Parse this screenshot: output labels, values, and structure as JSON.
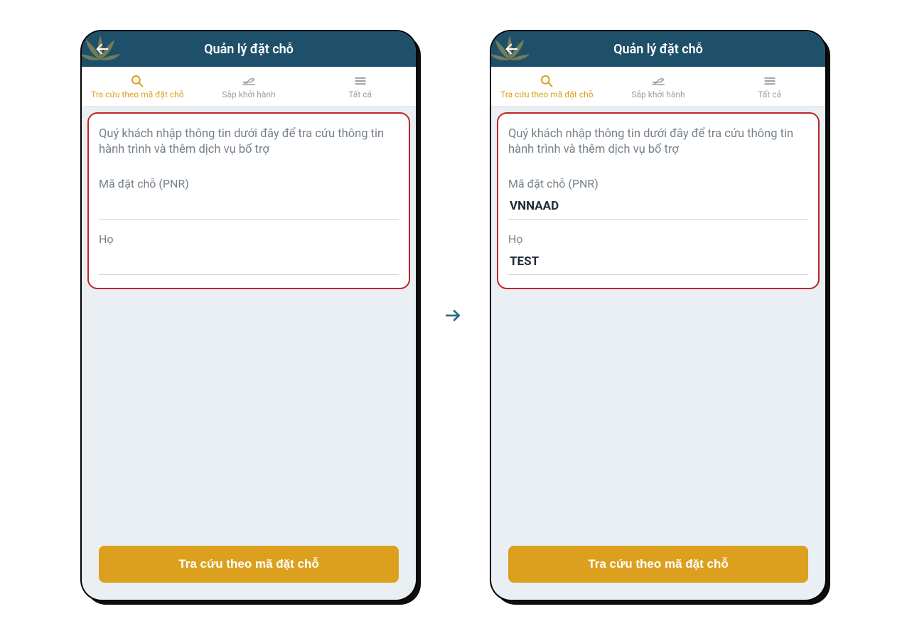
{
  "header": {
    "title": "Quản lý đặt chỗ"
  },
  "tabs": {
    "lookup": "Tra cứu theo mã đặt chỗ",
    "departing": "Sắp khởi hành",
    "all": "Tất cả"
  },
  "form": {
    "intro": "Quý khách nhập thông tin dưới đây để tra cứu thông tin hành trình và thêm dịch vụ bổ trợ",
    "pnr_label": "Mã đặt chỗ (PNR)",
    "lastname_label": "Họ"
  },
  "submit_label": "Tra cứu theo mã đặt chỗ",
  "screens": {
    "left": {
      "pnr_value": "",
      "lastname_value": ""
    },
    "right": {
      "pnr_value": "VNNAAD",
      "lastname_value": "TEST"
    }
  }
}
